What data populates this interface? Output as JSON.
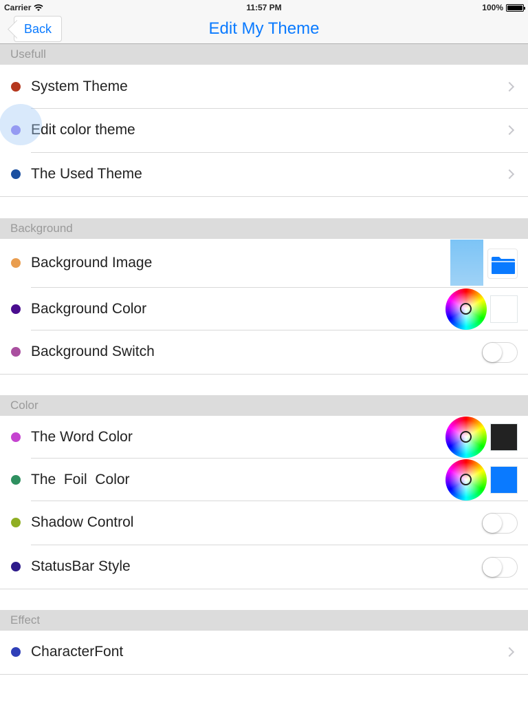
{
  "status_bar": {
    "carrier": "Carrier",
    "time": "11:57 PM",
    "battery": "100%"
  },
  "nav": {
    "back_label": "Back",
    "title": "Edit My Theme"
  },
  "sections": {
    "usefull": {
      "header": "Usefull",
      "rows": [
        {
          "label": "System Theme",
          "dot_color": "#b5381e"
        },
        {
          "label": "Edit color theme",
          "dot_color": "#8e7cf0"
        },
        {
          "label": "The Used Theme",
          "dot_color": "#1b4fa0"
        }
      ]
    },
    "background": {
      "header": "Background",
      "rows": [
        {
          "label": "Background Image",
          "dot_color": "#e99d4f"
        },
        {
          "label": "Background Color",
          "dot_color": "#4a0d8f",
          "swatch_color": "#ffffff"
        },
        {
          "label": "Background Switch",
          "dot_color": "#a94f9f",
          "toggle_on": false
        }
      ]
    },
    "color": {
      "header": "Color",
      "rows": [
        {
          "label": "The Word Color",
          "dot_color": "#c544d0",
          "swatch_color": "#222222"
        },
        {
          "label": "The  Foil  Color",
          "dot_color": "#2f9060",
          "swatch_color": "#0a7aff"
        },
        {
          "label": "Shadow Control",
          "dot_color": "#8fae23",
          "toggle_on": false
        },
        {
          "label": "StatusBar Style",
          "dot_color": "#2d1a8a",
          "toggle_on": false
        }
      ]
    },
    "effect": {
      "header": "Effect",
      "rows": [
        {
          "label": "CharacterFont",
          "dot_color": "#2f3fb8"
        }
      ]
    }
  },
  "colors": {
    "accent": "#0a7aff",
    "section_header_bg": "#dcdcdc",
    "section_header_text": "#9a9a9a"
  },
  "icons": {
    "folder": "folder-icon",
    "chevron": "chevron-right-icon",
    "color_wheel": "color-wheel-icon",
    "wifi": "wifi-icon",
    "battery": "battery-icon"
  }
}
